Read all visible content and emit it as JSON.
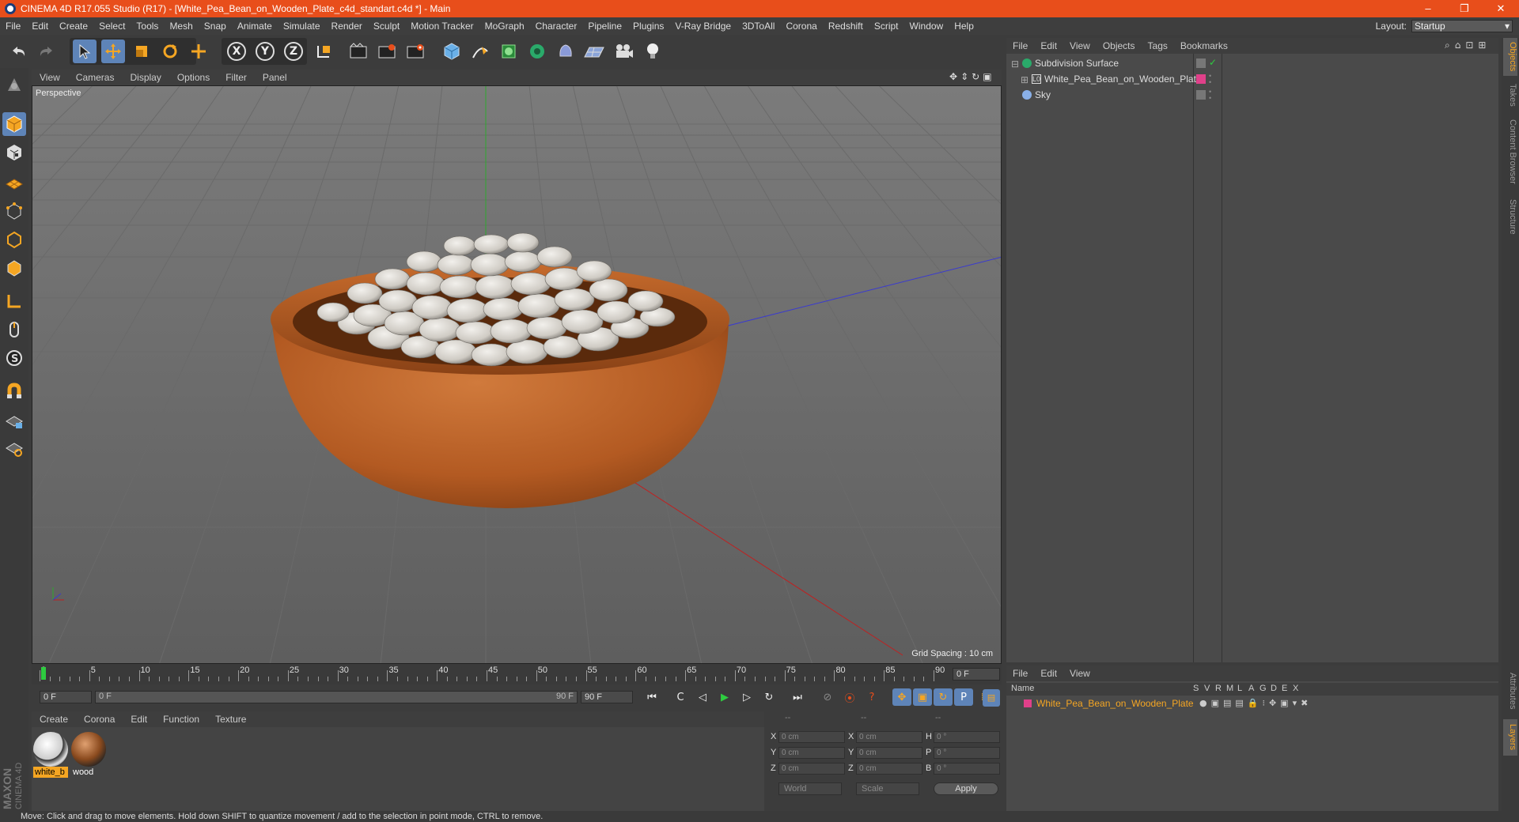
{
  "title": "CINEMA 4D R17.055 Studio (R17) - [White_Pea_Bean_on_Wooden_Plate_c4d_standart.c4d *] - Main",
  "menu": [
    "File",
    "Edit",
    "Create",
    "Select",
    "Tools",
    "Mesh",
    "Snap",
    "Animate",
    "Simulate",
    "Render",
    "Sculpt",
    "Motion Tracker",
    "MoGraph",
    "Character",
    "Pipeline",
    "Plugins",
    "V-Ray Bridge",
    "3DToAll",
    "Corona",
    "Redshift",
    "Script",
    "Window",
    "Help"
  ],
  "layout": {
    "label": "Layout:",
    "value": "Startup"
  },
  "toolbar": {
    "x_label": "X",
    "y_label": "Y",
    "z_label": "Z"
  },
  "viewport": {
    "menu": [
      "View",
      "Cameras",
      "Display",
      "Options",
      "Filter",
      "Panel"
    ],
    "label": "Perspective",
    "grid_spacing": "Grid Spacing : 10 cm"
  },
  "timeline": {
    "ticks": [
      "0",
      "5",
      "10",
      "15",
      "20",
      "25",
      "30",
      "35",
      "40",
      "45",
      "50",
      "55",
      "60",
      "65",
      "70",
      "75",
      "80",
      "85",
      "90"
    ],
    "current_frame": "0 F",
    "start_frame": "0 F",
    "range_start": "0 F",
    "range_end": "90 F",
    "end_frame": "90 F"
  },
  "material_manager": {
    "menu": [
      "Create",
      "Corona",
      "Edit",
      "Function",
      "Texture"
    ],
    "materials": [
      {
        "name": "white_b",
        "color": "#d8d8d8"
      },
      {
        "name": "wood",
        "color": "#8a4a1e"
      }
    ]
  },
  "coordinates": {
    "headers": [
      "--",
      "--",
      "--"
    ],
    "rows": [
      {
        "a_label": "X",
        "a_val": "0 cm",
        "b_label": "X",
        "b_val": "0 cm",
        "c_label": "H",
        "c_val": "0 °"
      },
      {
        "a_label": "Y",
        "a_val": "0 cm",
        "b_label": "Y",
        "b_val": "0 cm",
        "c_label": "P",
        "c_val": "0 °"
      },
      {
        "a_label": "Z",
        "a_val": "0 cm",
        "b_label": "Z",
        "b_val": "0 cm",
        "c_label": "B",
        "c_val": "0 °"
      }
    ],
    "mode1": "World",
    "mode2": "Scale",
    "apply": "Apply"
  },
  "object_manager": {
    "menu": [
      "File",
      "Edit",
      "View",
      "Objects",
      "Tags",
      "Bookmarks"
    ],
    "objects": [
      {
        "name": "Subdivision Surface",
        "icon": "subdivision-icon"
      },
      {
        "name": "White_Pea_Bean_on_Wooden_Plate",
        "icon": "null-object-icon"
      },
      {
        "name": "Sky",
        "icon": "sky-icon"
      }
    ]
  },
  "right_tabs": [
    "Objects",
    "Takes",
    "Content Browser",
    "Structure"
  ],
  "right_tabs_lower": [
    "Attributes",
    "Layers"
  ],
  "layer_manager": {
    "menu": [
      "File",
      "Edit",
      "View"
    ],
    "columns": [
      "Name",
      "S",
      "V",
      "R",
      "M",
      "L",
      "A",
      "G",
      "D",
      "E",
      "X"
    ],
    "layers": [
      {
        "name": "White_Pea_Bean_on_Wooden_Plate",
        "color": "#e0408a"
      }
    ]
  },
  "logo": {
    "line1": "MAXON",
    "line2": "CINEMA 4D"
  },
  "status": "Move: Click and drag to move elements. Hold down SHIFT to quantize movement / add to the selection in point mode, CTRL to remove.",
  "colors": {
    "title_bar": "#e84e1b",
    "selection": "#5e84b8",
    "layer_pink": "#e0408a"
  }
}
